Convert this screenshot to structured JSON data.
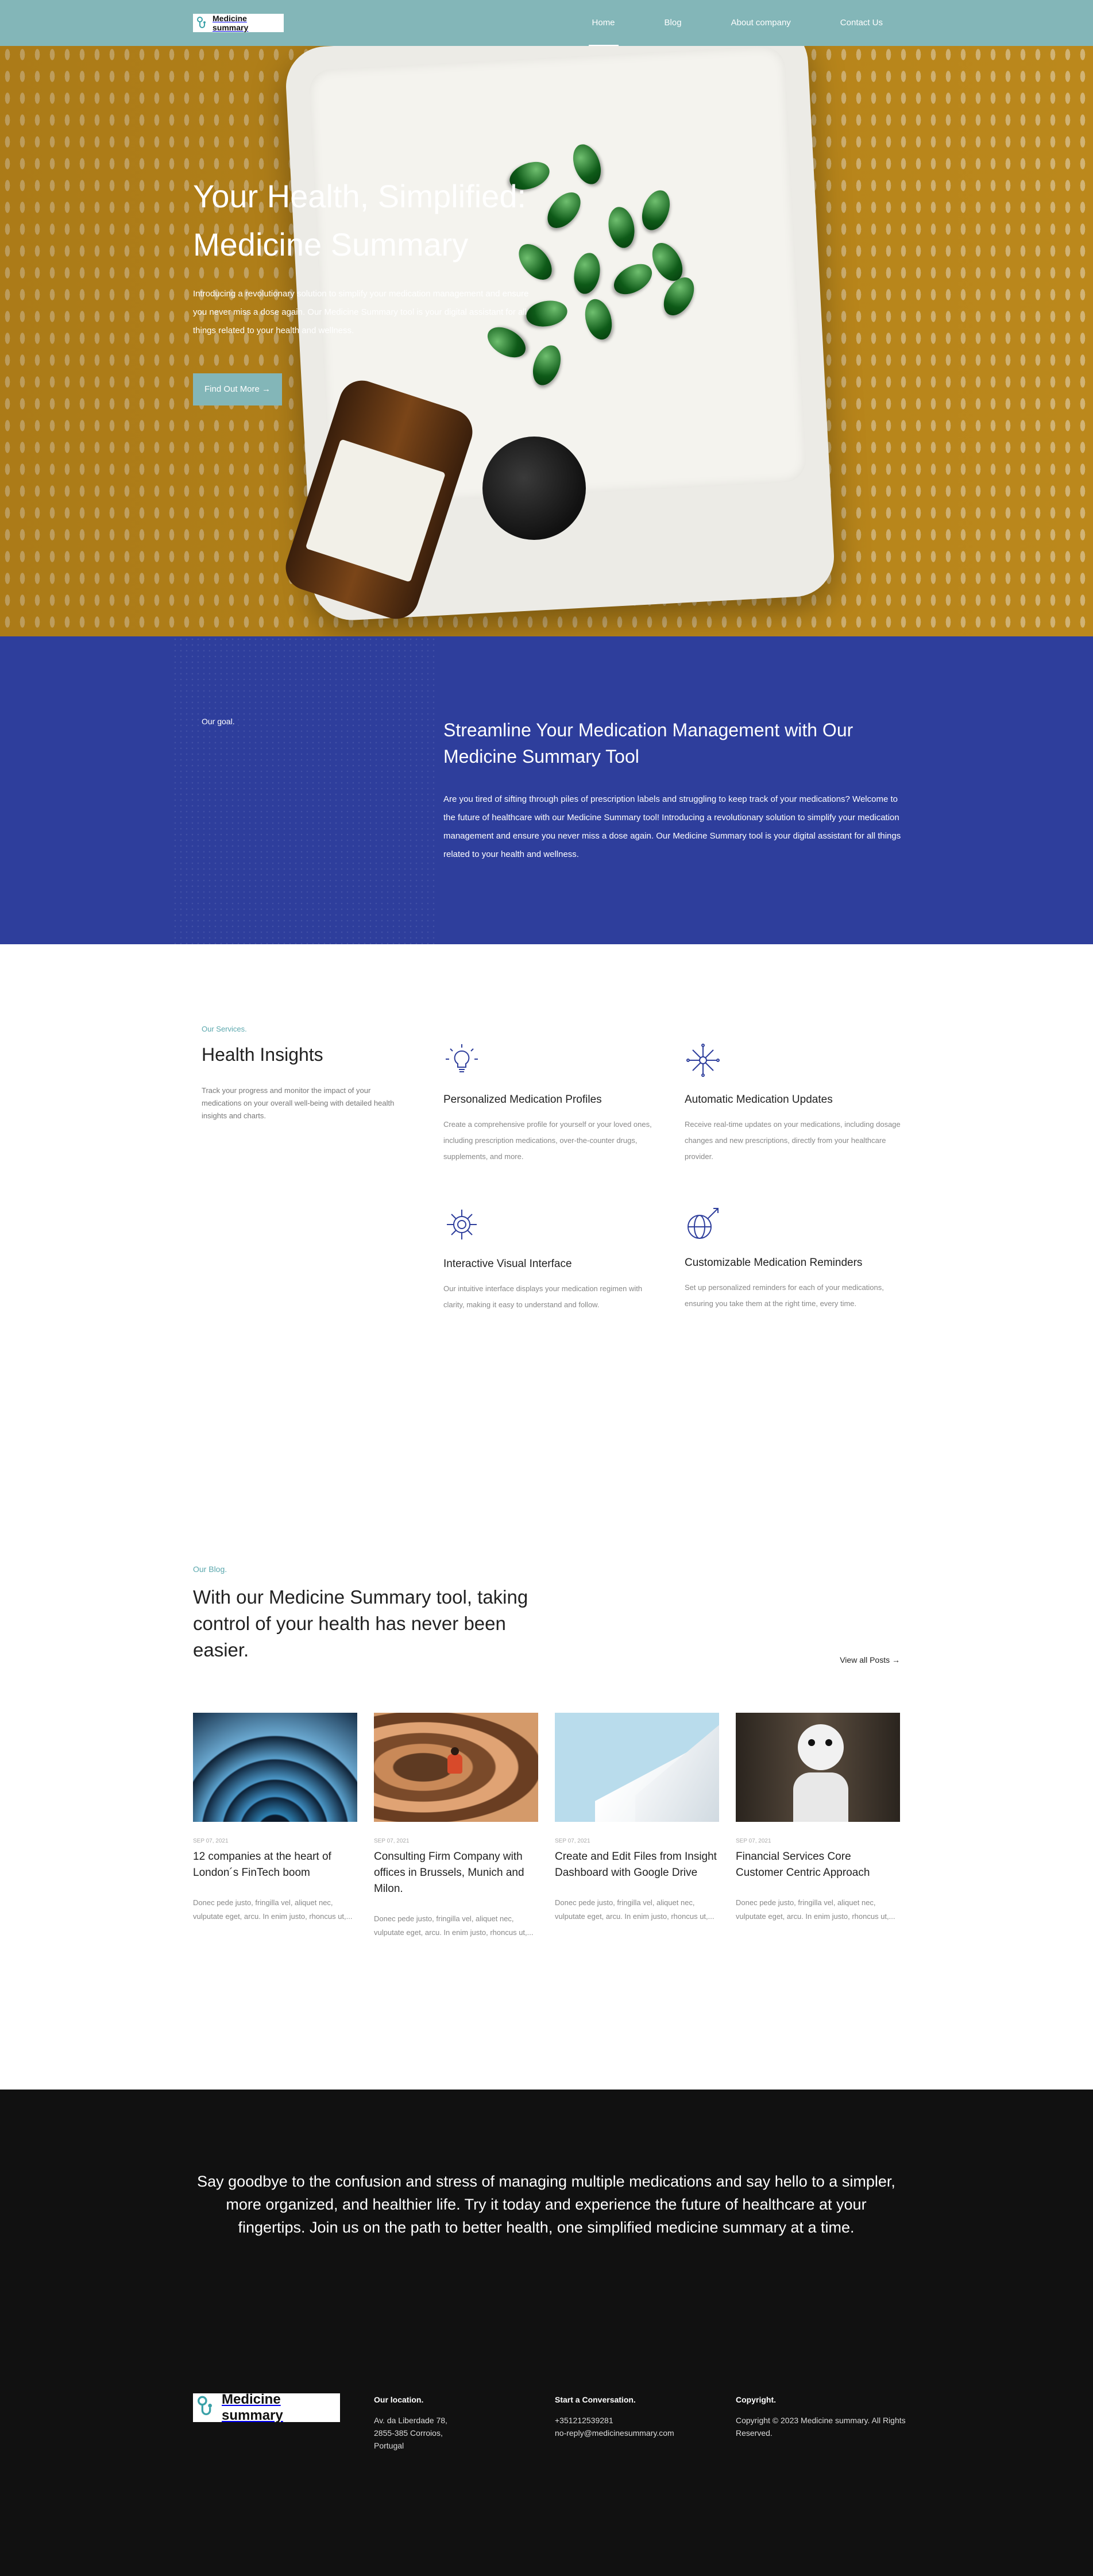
{
  "nav": {
    "brand": "Medicine summary",
    "items": [
      {
        "label": "Home"
      },
      {
        "label": "Blog"
      },
      {
        "label": "About company"
      },
      {
        "label": "Contact Us"
      }
    ]
  },
  "hero": {
    "title": "Your Health, Simplified: Medicine Summary",
    "text": "Introducing a revolutionary solution to simplify your medication management and ensure you never miss a dose again. Our Medicine Summary tool is your digital assistant for all things related to your health and wellness.",
    "button": "Find Out More →"
  },
  "goal": {
    "label": "Our goal.",
    "title": "Streamline Your Medication Management with Our Medicine Summary Tool",
    "text": "Are you tired of sifting through piles of prescription labels and struggling to keep track of your medications? Welcome to the future of healthcare with our Medicine Summary tool! Introducing a revolutionary solution to simplify your medication management and ensure you never miss a dose again. Our Medicine Summary tool is your digital assistant for all things related to your health and wellness."
  },
  "services": {
    "eyebrow": "Our Services.",
    "title": "Health Insights",
    "intro": "Track your progress and monitor the impact of your medications on your overall well-being with detailed health insights and charts.",
    "items": [
      {
        "icon": "lightbulb-icon",
        "title": "Personalized Medication Profiles",
        "text": "Create a comprehensive profile for yourself or your loved ones, including prescription medications, over-the-counter drugs, supplements, and more."
      },
      {
        "icon": "network-icon",
        "title": "Automatic Medication Updates",
        "text": "Receive real-time updates on your medications, including dosage changes and new prescriptions, directly from your healthcare provider."
      },
      {
        "icon": "virus-icon",
        "title": "Interactive Visual Interface",
        "text": "Our intuitive interface displays your medication regimen with clarity, making it easy to understand and follow."
      },
      {
        "icon": "globe-rocket-icon",
        "title": "Customizable Medication Reminders",
        "text": "Set up personalized reminders for each of your medications, ensuring you take them at the right time, every time."
      }
    ]
  },
  "blog": {
    "eyebrow": "Our Blog.",
    "title": "With our Medicine Summary tool, taking control of your health has never been easier.",
    "view_all": "View all Posts →",
    "posts": [
      {
        "date": "SEP 07, 2021",
        "title": "12 companies at the heart of London´s FinTech boom",
        "excerpt": "Donec pede justo, fringilla vel, aliquet nec, vulputate eget, arcu. In enim justo, rhoncus ut,..."
      },
      {
        "date": "SEP 07, 2021",
        "title": "Consulting Firm Company with offices in Brussels, Munich and Milon.",
        "excerpt": "Donec pede justo, fringilla vel, aliquet nec, vulputate eget, arcu. In enim justo, rhoncus ut,..."
      },
      {
        "date": "SEP 07, 2021",
        "title": "Create and Edit Files from Insight Dashboard with Google Drive",
        "excerpt": "Donec pede justo, fringilla vel, aliquet nec, vulputate eget, arcu. In enim justo, rhoncus ut,..."
      },
      {
        "date": "SEP 07, 2021",
        "title": "Financial Services Core Customer Centric Approach",
        "excerpt": "Donec pede justo, fringilla vel, aliquet nec, vulputate eget, arcu. In enim justo, rhoncus ut,..."
      }
    ]
  },
  "cta": {
    "text": "Say goodbye to the confusion and stress of managing multiple medications and say hello to a simpler, more organized, and healthier life. Try it today and experience the future of healthcare at your fingertips. Join us on the path to better health, one simplified medicine summary at a time."
  },
  "footer": {
    "brand": "Medicine summary",
    "location": {
      "title": "Our location.",
      "lines": [
        "Av. da Liberdade 78,",
        "2855-385 Corroios,",
        "Portugal"
      ]
    },
    "conversation": {
      "title": "Start a Conversation.",
      "phone": "+351212539281",
      "email": "no-reply@medicinesummary.com"
    },
    "copyright": {
      "title": "Copyright.",
      "text": "Copyright © 2023 Medicine summary. All Rights Reserved."
    }
  },
  "colors": {
    "nav": "#83b6b8",
    "accent": "#5aa7ad",
    "goal_bg": "#2e3e9c",
    "icon": "#2e3e9c",
    "dark": "#111111"
  }
}
